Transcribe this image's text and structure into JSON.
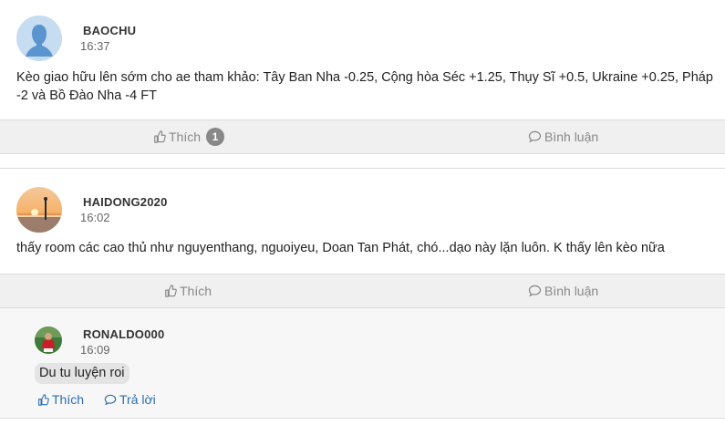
{
  "posts": [
    {
      "author": "BAOCHU",
      "time": "16:37",
      "content": "Kèo giao hữu lên sớm cho ae tham khảo: Tây Ban Nha -0.25, Cộng hòa Séc +1.25, Thụy Sĩ +0.5, Ukraine +0.25, Pháp -2 và Bồ Đào Nha -4 FT",
      "like_label": "Thích",
      "like_count": "1",
      "comment_label": "Bình luận"
    },
    {
      "author": "HAIDONG2020",
      "time": "16:02",
      "content": "thấy room các cao thủ như nguyenthang, nguoiyeu, Doan Tan Phát, chó...dạo này lặn luôn. K thấy lên kèo nữa",
      "like_label": "Thích",
      "comment_label": "Bình luận"
    }
  ],
  "reply": {
    "author": "RONALDO000",
    "time": "16:09",
    "content": "Du tu luyện roi",
    "like_label": "Thích",
    "reply_label": "Trả lời"
  },
  "colors": {
    "action_bar": "#f0f0f0",
    "reply_link": "#2b6cb0",
    "badge": "#888888"
  },
  "icons": [
    "default-user-avatar-icon",
    "sunset-avatar-photo",
    "football-player-avatar-photo",
    "thumbs-up-icon",
    "comment-bubble-icon"
  ]
}
